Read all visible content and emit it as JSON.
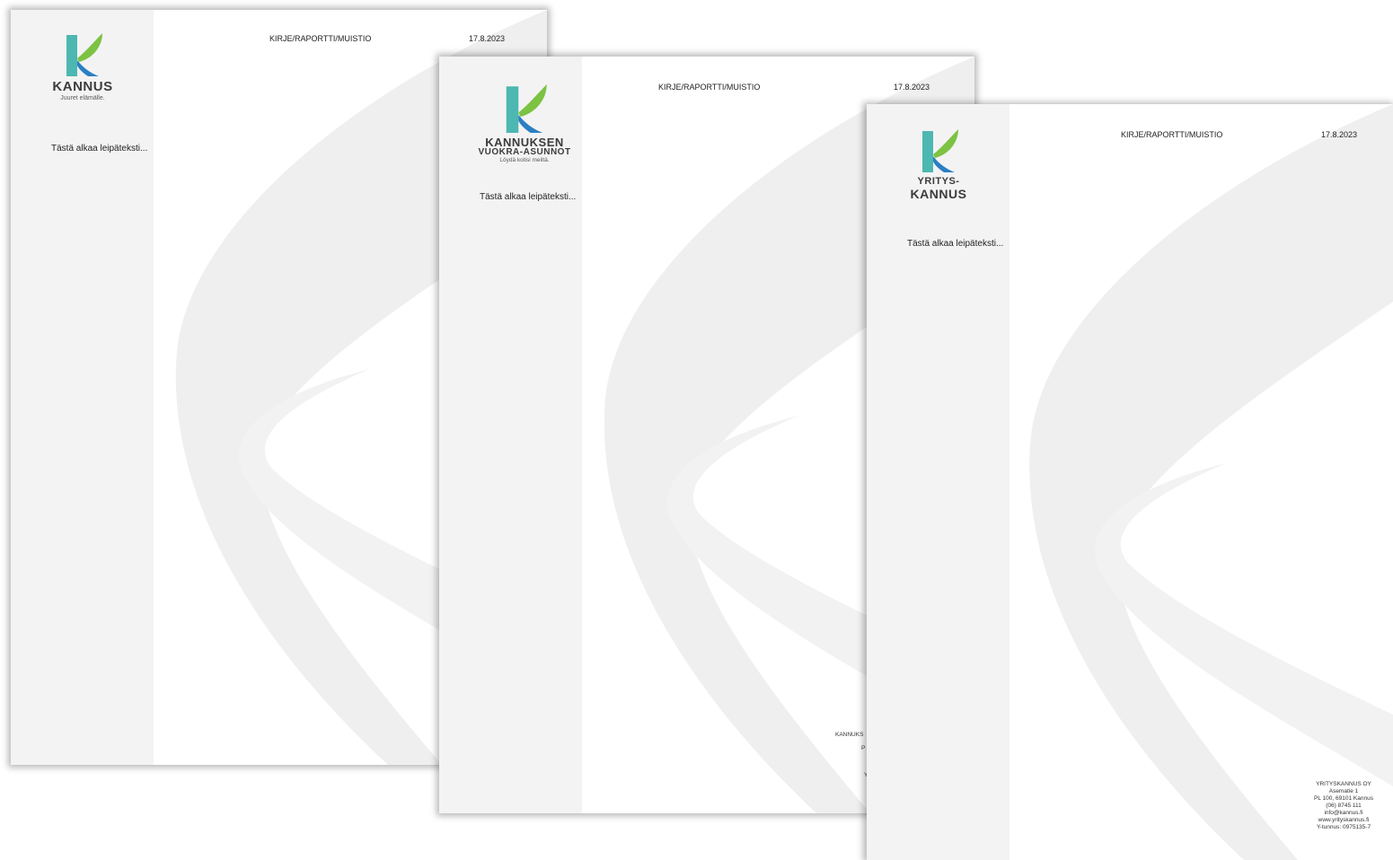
{
  "colors": {
    "sidebar": "#f3f3f3",
    "swoosh": "#efefef",
    "logo_teal": "#4db7b1",
    "logo_green": "#7cc243",
    "logo_blue": "#2b7fc4"
  },
  "sheets": [
    {
      "logo": {
        "name": "KANNUS",
        "tagline": "Juuret elämälle."
      },
      "doc_type": "KIRJE/RAPORTTI/MUISTIO",
      "date": "17.8.2023",
      "body": "Tästä alkaa leipäteksti..."
    },
    {
      "logo": {
        "name": "KANNUKSEN",
        "name2": "VUOKRA-ASUNNOT",
        "tagline": "Löydä kotisi meiltä."
      },
      "doc_type": "KIRJE/RAPORTTI/MUISTIO",
      "date": "17.8.2023",
      "body": "Tästä alkaa leipäteksti...",
      "footer_partial": [
        "KANNUKS",
        "P",
        "Y"
      ]
    },
    {
      "logo": {
        "name": "YRITYS-",
        "name2": "KANNUS"
      },
      "doc_type": "KIRJE/RAPORTTI/MUISTIO",
      "date": "17.8.2023",
      "body": "Tästä alkaa leipäteksti...",
      "footer": [
        "YRITYSKANNUS OY",
        "Asematie 1",
        "PL 100, 69101 Kannus",
        "(06) 8745 111",
        "info@kannus.fi",
        "www.yrityskannus.fi",
        "Y-tunnus: 0975135-7"
      ]
    }
  ]
}
